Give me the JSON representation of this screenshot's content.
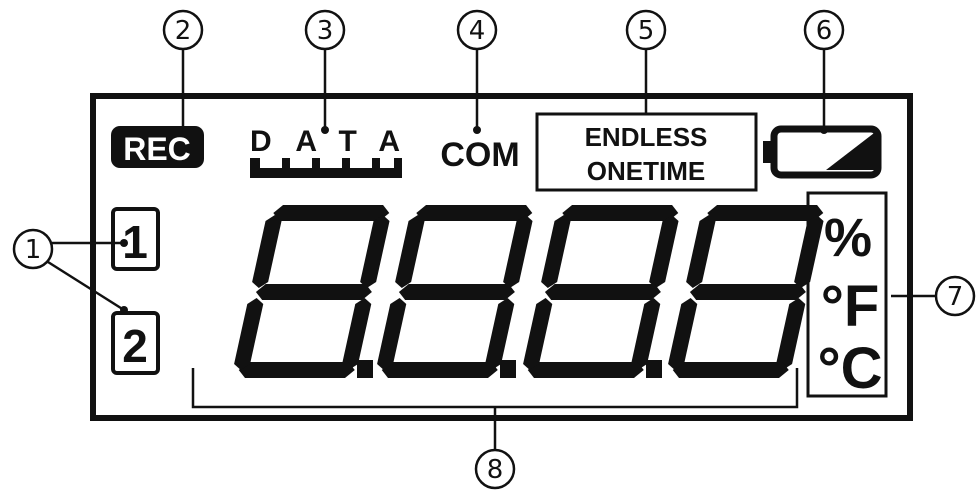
{
  "callouts": {
    "c1": "1",
    "c2": "2",
    "c3": "3",
    "c4": "4",
    "c5": "5",
    "c6": "6",
    "c7": "7",
    "c8": "8"
  },
  "indicators": {
    "rec": "REC",
    "data": "DATA",
    "com": "COM",
    "endless": "ENDLESS",
    "onetime": "ONETIME",
    "channel_1": "1",
    "channel_2": "2",
    "unit_percent": "%",
    "unit_f": "°F",
    "unit_c": "°C"
  },
  "icons": {
    "battery": "battery-icon",
    "data_blocks": "data-memory-bar-icon"
  },
  "display": {
    "digits": [
      "8",
      "8",
      "8",
      "8"
    ],
    "segment_style": "seven-segment"
  },
  "colors": {
    "ink": "#111111",
    "background": "#ffffff"
  }
}
